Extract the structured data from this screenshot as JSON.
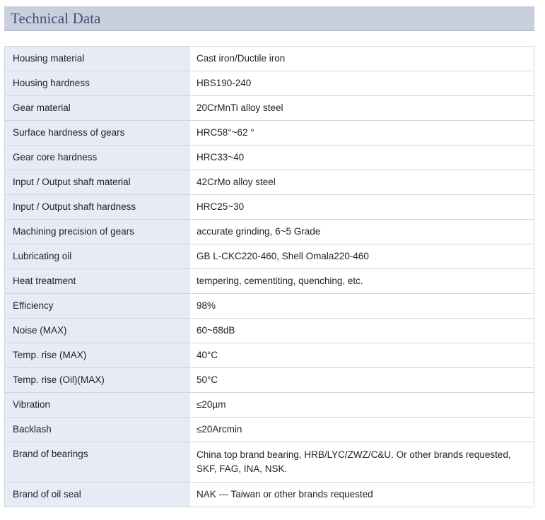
{
  "section_title": "Technical Data",
  "rows": [
    {
      "label": "Housing material",
      "value": "Cast iron/Ductile iron"
    },
    {
      "label": "Housing hardness",
      "value": "HBS190-240"
    },
    {
      "label": "Gear material",
      "value": "20CrMnTi alloy steel"
    },
    {
      "label": "Surface hardness of gears",
      "value": "HRC58°~62 °"
    },
    {
      "label": "Gear core hardness",
      "value": "HRC33~40"
    },
    {
      "label": "Input / Output shaft material",
      "value": "42CrMo alloy steel"
    },
    {
      "label": "Input / Output shaft hardness",
      "value": "HRC25~30"
    },
    {
      "label": "Machining precision of gears",
      "value": "accurate grinding, 6~5 Grade"
    },
    {
      "label": "Lubricating oil",
      "value": "GB L-CKC220-460, Shell Omala220-460"
    },
    {
      "label": "Heat treatment",
      "value": "tempering, cementiting, quenching, etc."
    },
    {
      "label": "Efficiency",
      "value": "98%"
    },
    {
      "label": "Noise (MAX)",
      "value": "60~68dB"
    },
    {
      "label": "Temp. rise (MAX)",
      "value": "40°C"
    },
    {
      "label": "Temp. rise (Oil)(MAX)",
      "value": "50°C"
    },
    {
      "label": "Vibration",
      "value": "≤20µm"
    },
    {
      "label": "Backlash",
      "value": "≤20Arcmin"
    },
    {
      "label": "Brand of bearings",
      "value": "China top brand bearing, HRB/LYC/ZWZ/C&U. Or other brands requested, SKF, FAG, INA, NSK."
    },
    {
      "label": "Brand of oil seal",
      "value": "NAK --- Taiwan or other brands requested"
    }
  ]
}
